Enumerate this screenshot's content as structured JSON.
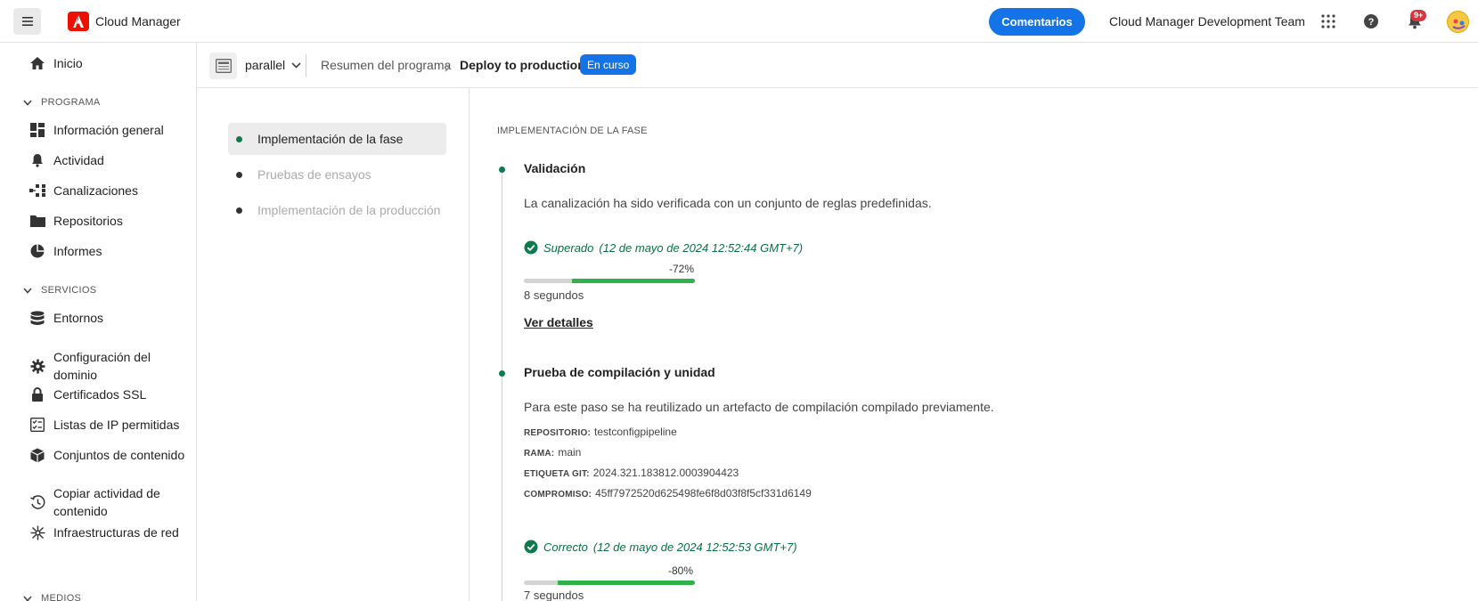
{
  "header": {
    "app_title": "Cloud Manager",
    "feedback_label": "Comentarios",
    "team_name": "Cloud Manager Development Team",
    "notification_count": "9+",
    "icons": [
      "menu-icon",
      "adobe-logo-icon",
      "apps-grid-icon",
      "help-icon",
      "bell-icon",
      "avatar"
    ]
  },
  "sidebar": {
    "home": "Inicio",
    "sections": [
      {
        "title": "PROGRAMA",
        "items": [
          "Información general",
          "Actividad",
          "Canalizaciones",
          "Repositorios",
          "Informes"
        ]
      },
      {
        "title": "SERVICIOS",
        "items": [
          "Entornos",
          "Configuración del dominio",
          "Certificados SSL",
          "Listas de IP permitidas",
          "Conjuntos de contenido",
          "Copiar actividad de contenido",
          "Infraestructuras de red"
        ]
      },
      {
        "title": "MEDIOS",
        "items": []
      }
    ]
  },
  "breadcrumb": {
    "program_name": "parallel",
    "summary": "Resumen del programa",
    "current": "Deploy to production",
    "status": "En curso"
  },
  "steps": [
    {
      "label": "Implementación de la fase",
      "active": true
    },
    {
      "label": "Pruebas de ensayos",
      "active": false
    },
    {
      "label": "Implementación de la producción",
      "active": false
    }
  ],
  "detail": {
    "section_title": "IMPLEMENTACIÓN DE LA FASE",
    "validation": {
      "title": "Validación",
      "description": "La canalización ha sido verificada con un conjunto de reglas predefinidas.",
      "status": "Superado",
      "timestamp": "(12 de mayo de 2024 12:52:44 GMT+7)",
      "percent": "-72%",
      "progress": 0.72,
      "duration": "8 segundos",
      "details_link": "Ver detalles"
    },
    "build": {
      "title": "Prueba de compilación y unidad",
      "description": "Para este paso se ha reutilizado un artefacto de compilación compilado previamente.",
      "fields": [
        {
          "key": "REPOSITORIO:",
          "value": "testconfigpipeline"
        },
        {
          "key": "RAMA:",
          "value": "main"
        },
        {
          "key": "ETIQUETA GIT:",
          "value": "2024.321.183812.0003904423"
        },
        {
          "key": "COMPROMISO:",
          "value": "45ff7972520d625498fe6f8d03f8f5cf331d6149"
        }
      ],
      "status": "Correcto",
      "timestamp": "(12 de mayo de 2024 12:52:53 GMT+7)",
      "percent": "-80%",
      "progress": 0.8,
      "duration": "7 segundos"
    }
  },
  "colors": {
    "accent": "#1473e6",
    "success": "#0d6e44",
    "progress_fill": "#2fb24a",
    "adobe_red": "#eb1000"
  }
}
